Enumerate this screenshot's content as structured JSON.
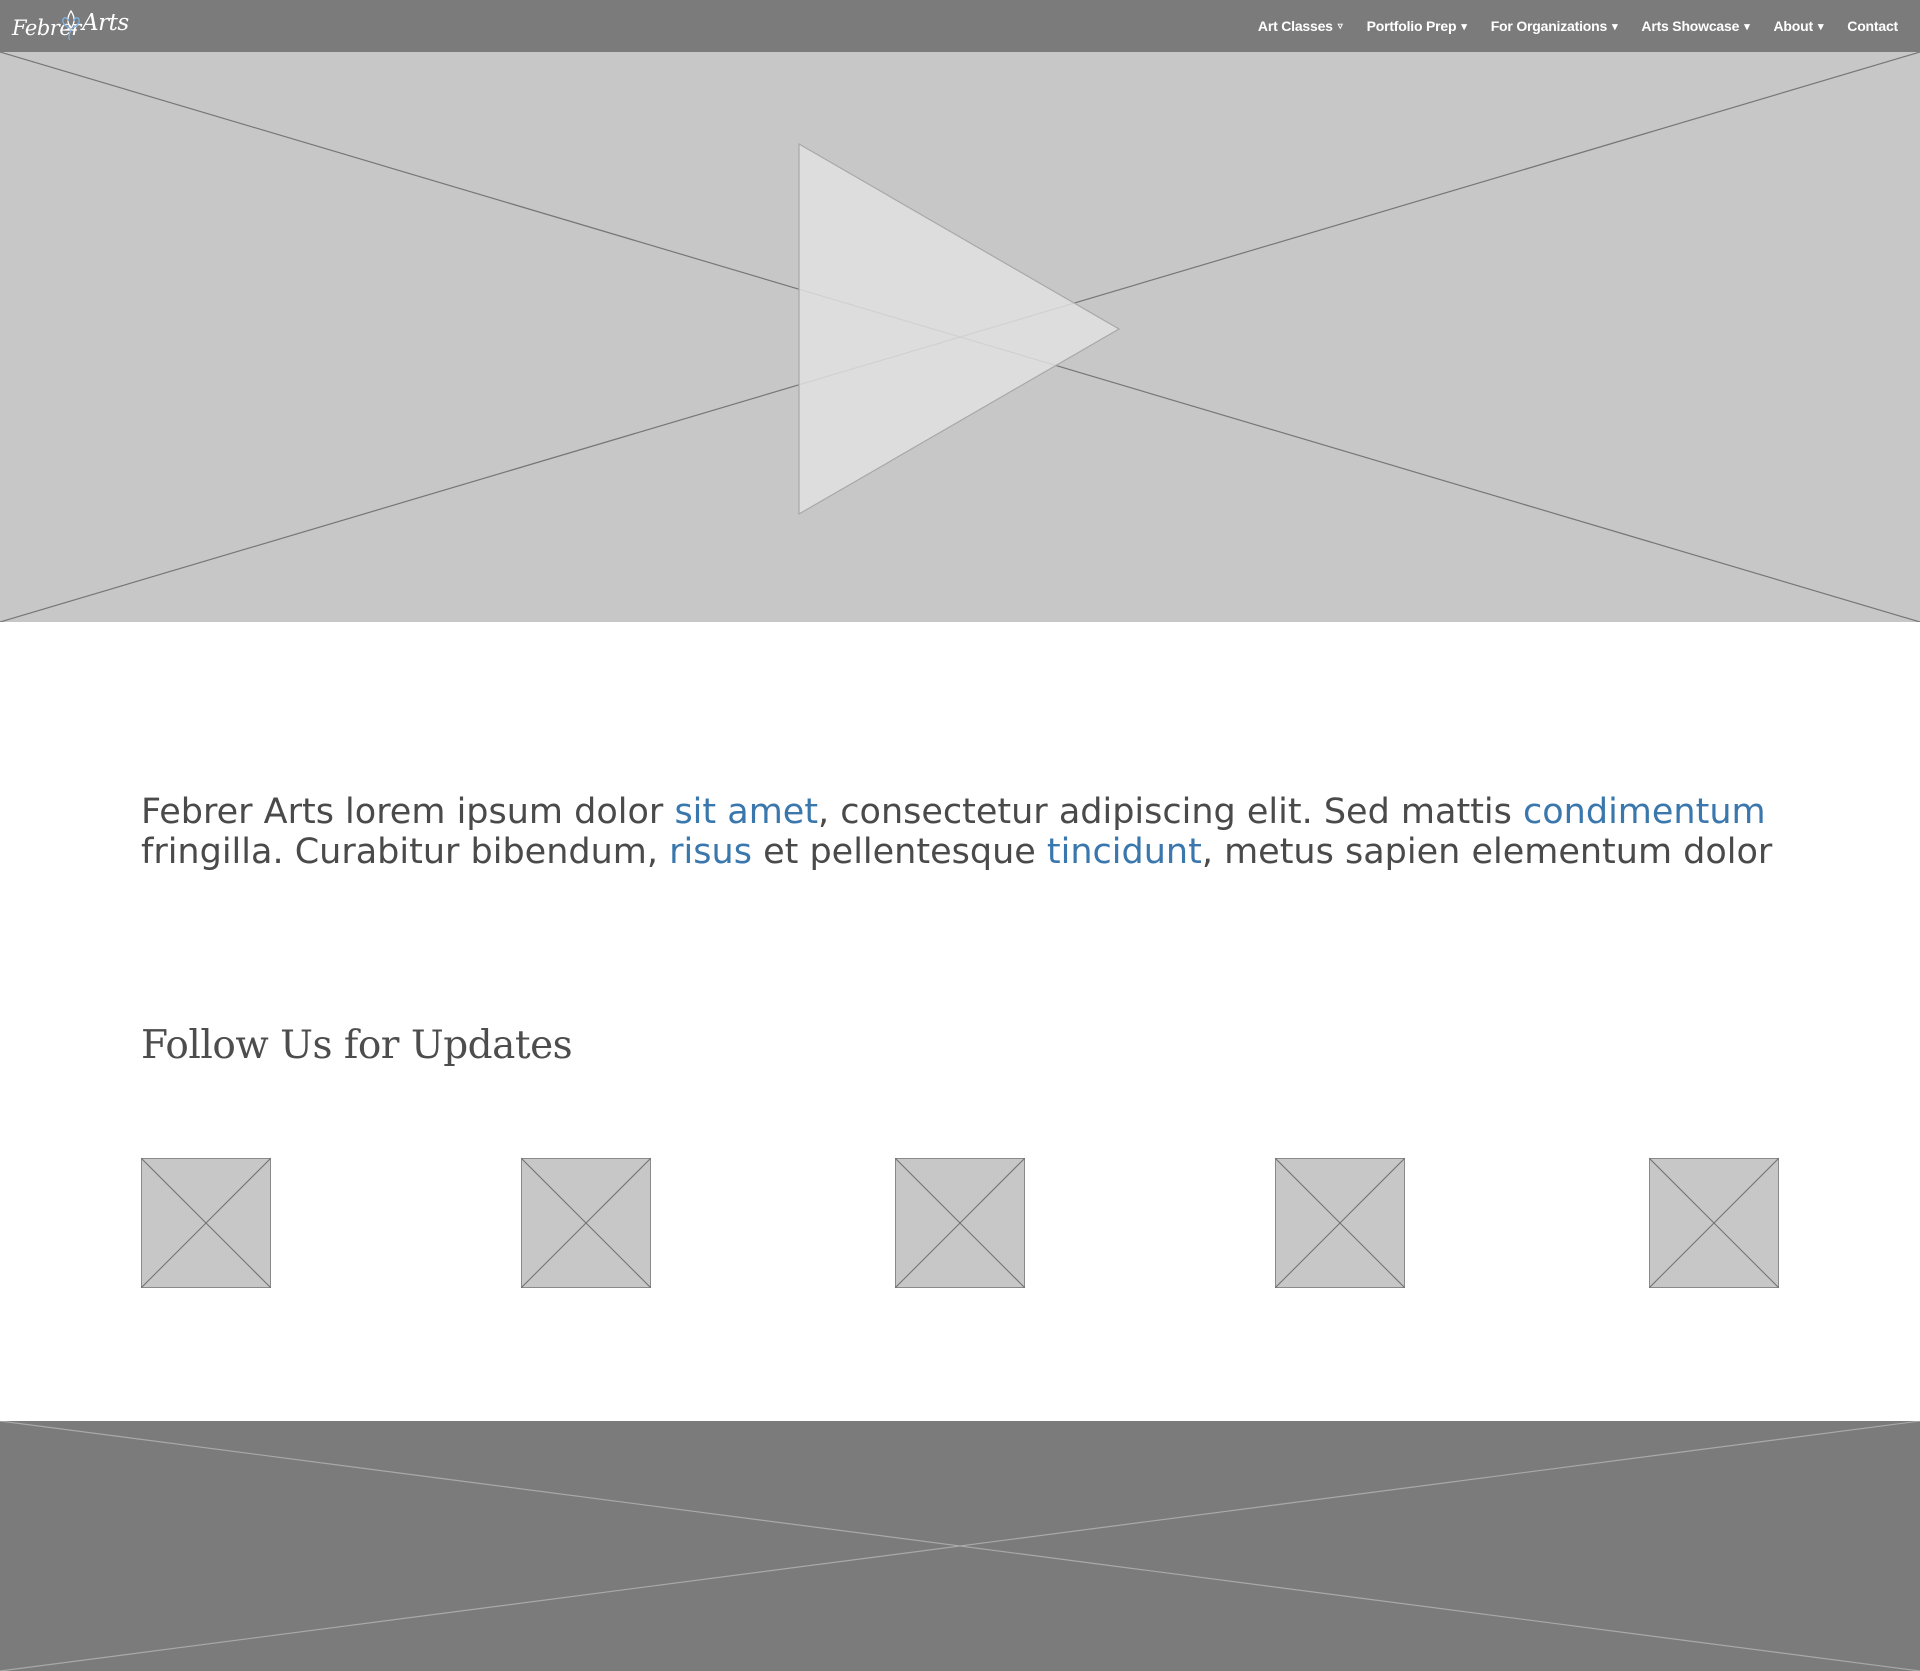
{
  "brand": {
    "logo_word_1": "Febrer",
    "logo_word_2": "Arts"
  },
  "nav": [
    {
      "label": "Art Classes",
      "caret": "▿"
    },
    {
      "label": "Portfolio Prep",
      "caret": "▾"
    },
    {
      "label": "For Organizations",
      "caret": "▾"
    },
    {
      "label": "Arts Showcase",
      "caret": "▾"
    },
    {
      "label": "About",
      "caret": "▾"
    },
    {
      "label": "Contact"
    }
  ],
  "intro": {
    "segments": [
      {
        "text": "Febrer Arts lorem ipsum dolor "
      },
      {
        "text": "sit amet",
        "link": true
      },
      {
        "text": ", consectetur adipiscing elit. Sed mattis "
      },
      {
        "text": "condimentum",
        "link": true
      },
      {
        "text": " fringilla. Curabitur bibendum, "
      },
      {
        "text": "risus",
        "link": true
      },
      {
        "text": " et pellentesque "
      },
      {
        "text": "tincidunt",
        "link": true
      },
      {
        "text": ", metus sapien elementum dolor"
      }
    ]
  },
  "follow": {
    "heading": "Follow Us for Updates"
  },
  "colors": {
    "nav_background": "#7b7b7b",
    "placeholder_fill": "#c7c7c7",
    "link": "#3a77ad",
    "body_text": "#4a4a4a"
  }
}
